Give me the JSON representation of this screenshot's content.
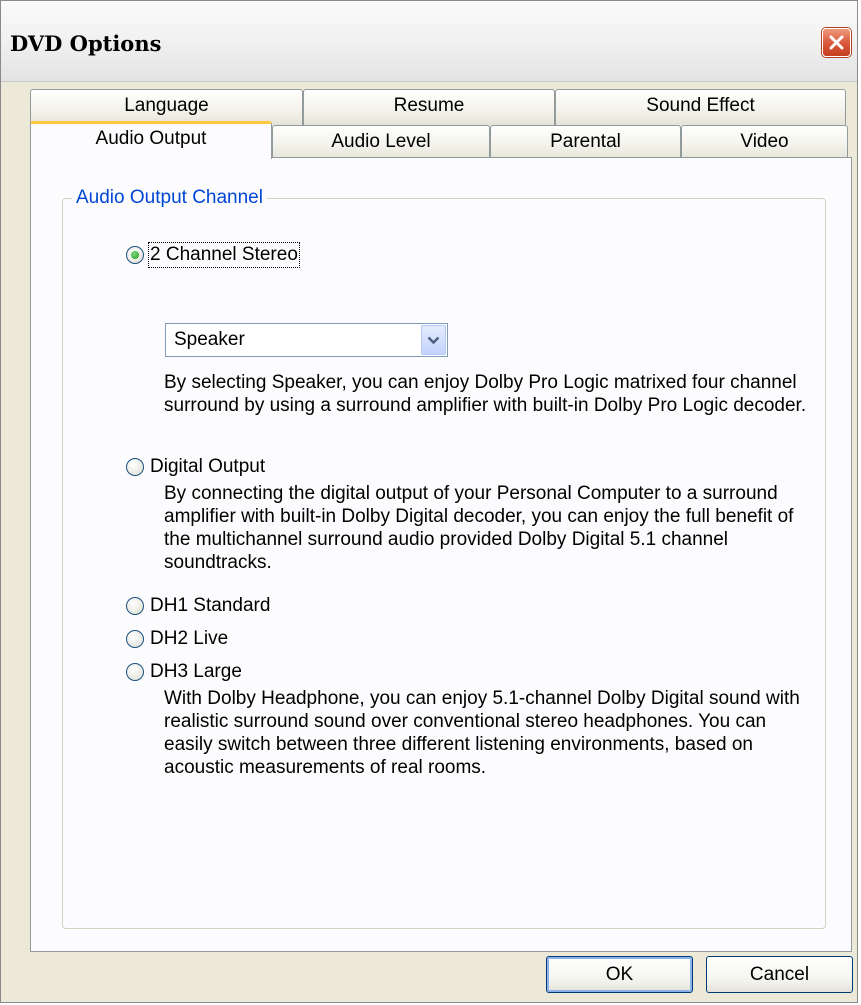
{
  "window": {
    "title": "DVD Options"
  },
  "tabs": {
    "row1": [
      {
        "label": "Language"
      },
      {
        "label": "Resume"
      },
      {
        "label": "Sound Effect"
      }
    ],
    "row2": [
      {
        "label": "Audio Output",
        "active": true
      },
      {
        "label": "Audio Level"
      },
      {
        "label": "Parental"
      },
      {
        "label": "Video"
      }
    ]
  },
  "group": {
    "title": "Audio Output Channel",
    "options": {
      "stereo": {
        "label": "2 Channel Stereo",
        "selected": true
      },
      "digital": {
        "label": "Digital Output",
        "selected": false
      },
      "dh1": {
        "label": "DH1 Standard",
        "selected": false
      },
      "dh2": {
        "label": "DH2 Live",
        "selected": false
      },
      "dh3": {
        "label": "DH3 Large",
        "selected": false
      }
    },
    "speaker_select": {
      "value": "Speaker"
    },
    "stereo_desc": "By selecting Speaker, you can enjoy Dolby Pro Logic matrixed four channel surround by using a surround amplifier with built-in Dolby Pro Logic decoder.",
    "digital_desc": "By connecting the digital output of your Personal Computer to a surround amplifier with built-in Dolby Digital decoder, you can enjoy the full benefit of the multichannel surround audio provided Dolby Digital 5.1 channel soundtracks.",
    "headphone_desc": "With Dolby Headphone, you can enjoy 5.1-channel Dolby Digital sound with realistic surround sound over conventional stereo headphones. You can easily switch between three different listening environments, based on acoustic measurements of real rooms."
  },
  "buttons": {
    "ok": "OK",
    "cancel": "Cancel"
  },
  "colors": {
    "accent_tab": "#ffc83c",
    "group_title": "#0046d5",
    "close": "#d9563a"
  }
}
